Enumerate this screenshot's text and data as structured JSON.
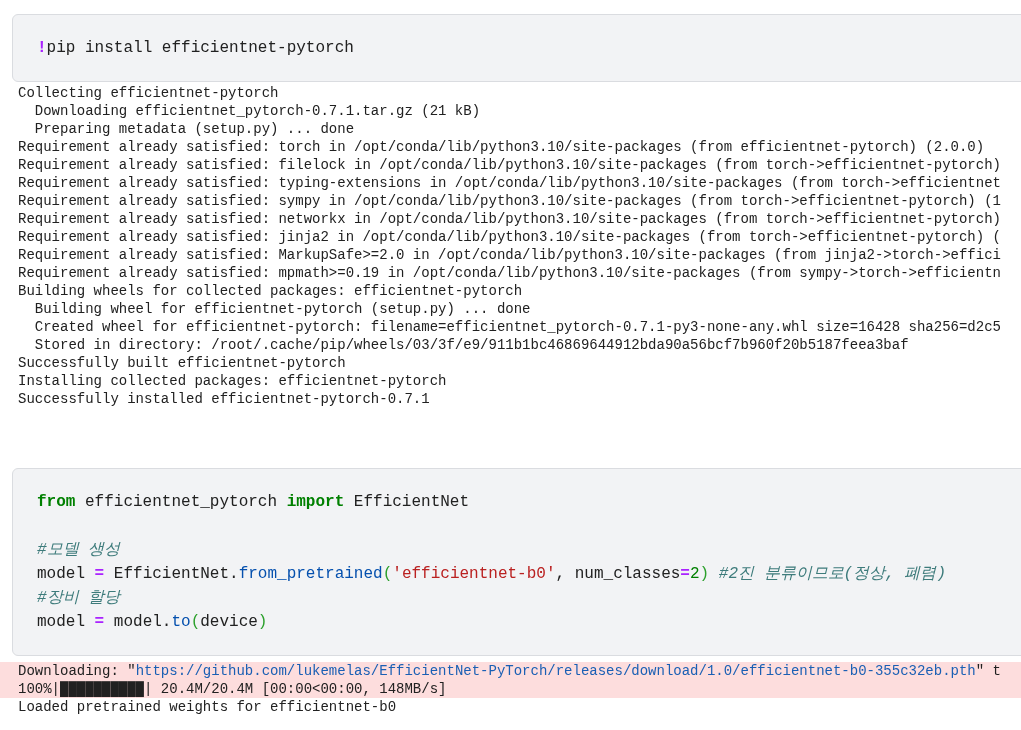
{
  "cells": [
    {
      "code": [
        [
          {
            "kind": "magic",
            "text": "!"
          },
          {
            "kind": "plain",
            "text": "pip install efficientnet-pytorch"
          }
        ]
      ],
      "outputs": [
        {
          "kind": "stdout",
          "lines": [
            [
              {
                "kind": "plain",
                "text": "Collecting efficientnet-pytorch"
              }
            ],
            [
              {
                "kind": "plain",
                "text": "  Downloading efficientnet_pytorch-0.7.1.tar.gz (21 kB)"
              }
            ],
            [
              {
                "kind": "plain",
                "text": "  Preparing metadata (setup.py) ... done"
              }
            ],
            [
              {
                "kind": "plain",
                "text": "Requirement already satisfied: torch in /opt/conda/lib/python3.10/site-packages (from efficientnet-pytorch) (2.0.0)"
              }
            ],
            [
              {
                "kind": "plain",
                "text": "Requirement already satisfied: filelock in /opt/conda/lib/python3.10/site-packages (from torch->efficientnet-pytorch)"
              }
            ],
            [
              {
                "kind": "plain",
                "text": "Requirement already satisfied: typing-extensions in /opt/conda/lib/python3.10/site-packages (from torch->efficientnet"
              }
            ],
            [
              {
                "kind": "plain",
                "text": "Requirement already satisfied: sympy in /opt/conda/lib/python3.10/site-packages (from torch->efficientnet-pytorch) (1"
              }
            ],
            [
              {
                "kind": "plain",
                "text": "Requirement already satisfied: networkx in /opt/conda/lib/python3.10/site-packages (from torch->efficientnet-pytorch)"
              }
            ],
            [
              {
                "kind": "plain",
                "text": "Requirement already satisfied: jinja2 in /opt/conda/lib/python3.10/site-packages (from torch->efficientnet-pytorch) ("
              }
            ],
            [
              {
                "kind": "plain",
                "text": "Requirement already satisfied: MarkupSafe>=2.0 in /opt/conda/lib/python3.10/site-packages (from jinja2->torch->effici"
              }
            ],
            [
              {
                "kind": "plain",
                "text": "Requirement already satisfied: mpmath>=0.19 in /opt/conda/lib/python3.10/site-packages (from sympy->torch->efficientn"
              }
            ],
            [
              {
                "kind": "plain",
                "text": "Building wheels for collected packages: efficientnet-pytorch"
              }
            ],
            [
              {
                "kind": "plain",
                "text": "  Building wheel for efficientnet-pytorch (setup.py) ... done"
              }
            ],
            [
              {
                "kind": "plain",
                "text": "  Created wheel for efficientnet-pytorch: filename=efficientnet_pytorch-0.7.1-py3-none-any.whl size=16428 sha256=d2c5"
              }
            ],
            [
              {
                "kind": "plain",
                "text": "  Stored in directory: /root/.cache/pip/wheels/03/3f/e9/911b1bc46869644912bda90a56bcf7b960f20b5187feea3baf"
              }
            ],
            [
              {
                "kind": "plain",
                "text": "Successfully built efficientnet-pytorch"
              }
            ],
            [
              {
                "kind": "plain",
                "text": "Installing collected packages: efficientnet-pytorch"
              }
            ],
            [
              {
                "kind": "plain",
                "text": "Successfully installed efficientnet-pytorch-0.7.1"
              }
            ]
          ]
        }
      ]
    },
    {
      "code": [
        [
          {
            "kind": "keyword",
            "text": "from"
          },
          {
            "kind": "plain",
            "text": " efficientnet_pytorch "
          },
          {
            "kind": "keyword",
            "text": "import"
          },
          {
            "kind": "plain",
            "text": " EfficientNet"
          }
        ],
        [
          {
            "kind": "blank"
          }
        ],
        [
          {
            "kind": "comment",
            "text": "#모델 생성"
          }
        ],
        [
          {
            "kind": "plain",
            "text": "model "
          },
          {
            "kind": "operator",
            "text": "="
          },
          {
            "kind": "plain",
            "text": " EfficientNet."
          },
          {
            "kind": "function",
            "text": "from_pretrained"
          },
          {
            "kind": "paren",
            "text": "("
          },
          {
            "kind": "string",
            "text": "'efficientnet-b0'"
          },
          {
            "kind": "plain",
            "text": ", num_classes"
          },
          {
            "kind": "operator",
            "text": "="
          },
          {
            "kind": "number",
            "text": "2"
          },
          {
            "kind": "paren",
            "text": ")"
          },
          {
            "kind": "comment",
            "text": " #2진 분류이므로(정상, 폐렴)"
          }
        ],
        [
          {
            "kind": "comment",
            "text": "#장비 할당"
          }
        ],
        [
          {
            "kind": "plain",
            "text": "model "
          },
          {
            "kind": "operator",
            "text": "="
          },
          {
            "kind": "plain",
            "text": " model."
          },
          {
            "kind": "function",
            "text": "to"
          },
          {
            "kind": "paren",
            "text": "("
          },
          {
            "kind": "plain",
            "text": "device"
          },
          {
            "kind": "paren",
            "text": ")"
          }
        ]
      ],
      "outputs": [
        {
          "kind": "stderr",
          "lines": [
            [
              {
                "kind": "plain",
                "text": "Downloading: \""
              },
              {
                "kind": "link",
                "text": "https://github.com/lukemelas/EfficientNet-PyTorch/releases/download/1.0/efficientnet-b0-355c32eb.pth"
              },
              {
                "kind": "plain",
                "text": "\" t"
              }
            ],
            [
              {
                "kind": "plain",
                "text": "100%|██████████| 20.4M/20.4M [00:00<00:00, 148MB/s]"
              }
            ]
          ]
        },
        {
          "kind": "stdout",
          "lines": [
            [
              {
                "kind": "plain",
                "text": "Loaded pretrained weights for efficientnet-b0"
              }
            ]
          ]
        }
      ]
    }
  ]
}
